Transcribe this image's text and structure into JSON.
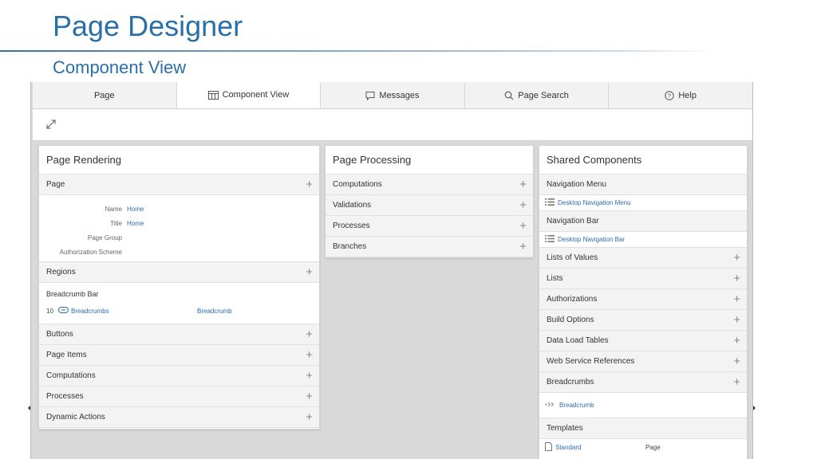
{
  "slide": {
    "title": "Page Designer",
    "subtitle": "Component View"
  },
  "tabs": [
    {
      "label": "Page",
      "icon": "none",
      "active": false
    },
    {
      "label": "Component View",
      "icon": "grid-icon",
      "active": true
    },
    {
      "label": "Messages",
      "icon": "speech-bubble-icon",
      "active": false
    },
    {
      "label": "Page Search",
      "icon": "search-icon",
      "active": false
    },
    {
      "label": "Help",
      "icon": "help-icon",
      "active": false
    }
  ],
  "rendering": {
    "title": "Page Rendering",
    "page_section": "Page",
    "props": [
      {
        "label": "Name",
        "value": "Home"
      },
      {
        "label": "Title",
        "value": "Home"
      },
      {
        "label": "Page Group",
        "value": ""
      },
      {
        "label": "Authorization Scheme",
        "value": ""
      }
    ],
    "regions_section": "Regions",
    "region_group": "Breadcrumb Bar",
    "region": {
      "seq": "10",
      "name": "Breadcrumbs",
      "template": "Breadcrumb"
    },
    "sections": [
      "Buttons",
      "Page Items",
      "Computations",
      "Processes",
      "Dynamic Actions"
    ]
  },
  "processing": {
    "title": "Page Processing",
    "sections": [
      "Computations",
      "Validations",
      "Processes",
      "Branches"
    ]
  },
  "shared": {
    "title": "Shared Components",
    "nav_menu": "Navigation Menu",
    "nav_menu_link": "Desktop Navigation Menu",
    "nav_bar": "Navigation Bar",
    "nav_bar_link": "Desktop Navigation Bar",
    "sections": [
      "Lists of Values",
      "Lists",
      "Authorizations",
      "Build Options",
      "Data Load Tables",
      "Web Service References"
    ],
    "breadcrumbs": "Breadcrumbs",
    "breadcrumbs_link": "Breadcrumb",
    "templates": "Templates",
    "template": {
      "name": "Standard",
      "type": "Page"
    }
  },
  "colors": {
    "accent": "#2b6fa8",
    "link": "#2a6db0"
  }
}
